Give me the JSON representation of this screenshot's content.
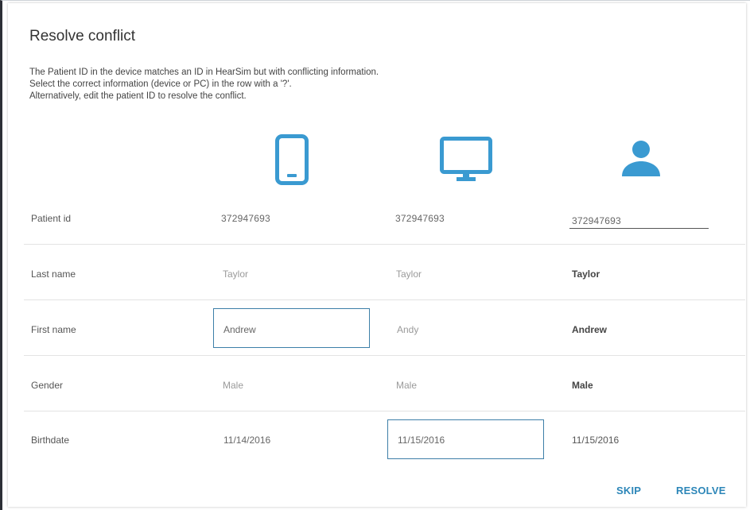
{
  "dialog": {
    "title": "Resolve conflict",
    "description": [
      "The Patient ID in the device matches an ID in HearSim but with conflicting information.",
      "Select the correct information (device or PC) in the row with a '?'.",
      "Alternatively, edit the patient ID to resolve the conflict."
    ]
  },
  "columns": {
    "device_icon": "phone-icon",
    "pc_icon": "monitor-icon",
    "result_icon": "person-icon",
    "icon_color": "#3a9ad1"
  },
  "rows": {
    "patient_id": {
      "label": "Patient id",
      "device": "372947693",
      "pc": "372947693",
      "result": "372947693"
    },
    "last_name": {
      "label": "Last name",
      "device": "Taylor",
      "pc": "Taylor",
      "result": "Taylor"
    },
    "first_name": {
      "label": "First name",
      "device": "Andrew",
      "pc": "Andy",
      "result": "Andrew"
    },
    "gender": {
      "label": "Gender",
      "device": "Male",
      "pc": "Male",
      "result": "Male"
    },
    "birthdate": {
      "label": "Birthdate",
      "device": "11/14/2016",
      "pc": "11/15/2016",
      "result": "11/15/2016"
    }
  },
  "actions": {
    "skip": "SKIP",
    "resolve": "RESOLVE",
    "accent": "#2c86b8"
  }
}
